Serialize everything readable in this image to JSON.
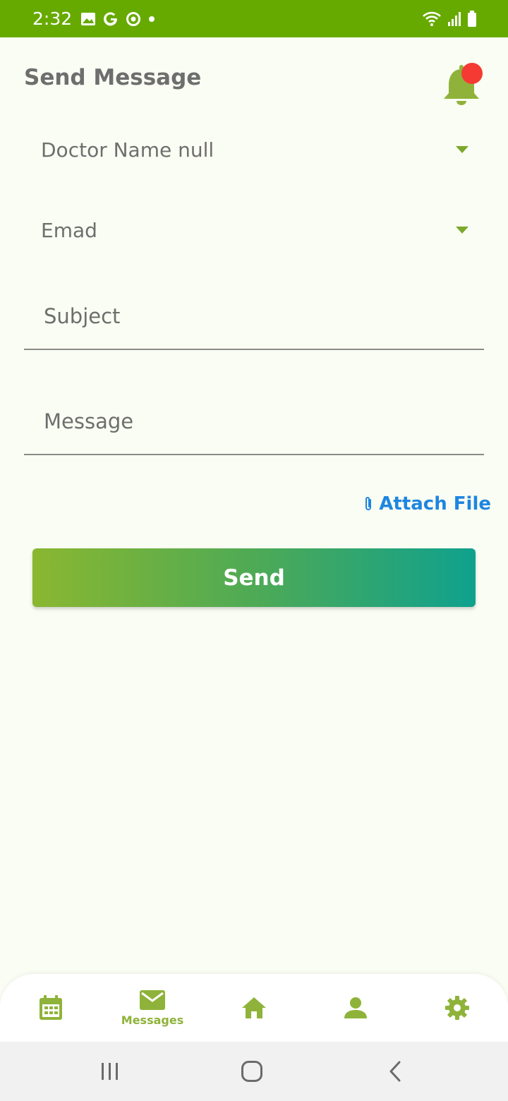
{
  "status_bar": {
    "time": "2:32",
    "left_icons": [
      "gallery-icon",
      "google-icon",
      "sync-icon",
      "dot-icon"
    ],
    "right_icons": [
      "wifi-icon",
      "signal-icon",
      "battery-icon"
    ]
  },
  "header": {
    "title": "Send Message",
    "notification_icon": "bell-icon",
    "notification_badge_color": "#f53a34"
  },
  "form": {
    "doctor_select": {
      "value": "Doctor Name null"
    },
    "patient_select": {
      "value": "Emad"
    },
    "subject": {
      "placeholder": "Subject",
      "value": ""
    },
    "message": {
      "placeholder": "Message",
      "value": ""
    },
    "attach_label": "Attach File",
    "send_label": "Send"
  },
  "bottom_nav": {
    "items": [
      {
        "icon": "calendar-icon",
        "label": "",
        "active": false
      },
      {
        "icon": "mail-icon",
        "label": "Messages",
        "active": true
      },
      {
        "icon": "home-icon",
        "label": "",
        "active": false
      },
      {
        "icon": "person-icon",
        "label": "",
        "active": false
      },
      {
        "icon": "gear-icon",
        "label": "",
        "active": false
      }
    ]
  },
  "colors": {
    "status_bar": "#66aa00",
    "accent": "#8fb33a",
    "link": "#1e86e0",
    "button_gradient_start": "#8ab730",
    "button_gradient_end": "#0fa18e",
    "background": "#fafdf3"
  }
}
